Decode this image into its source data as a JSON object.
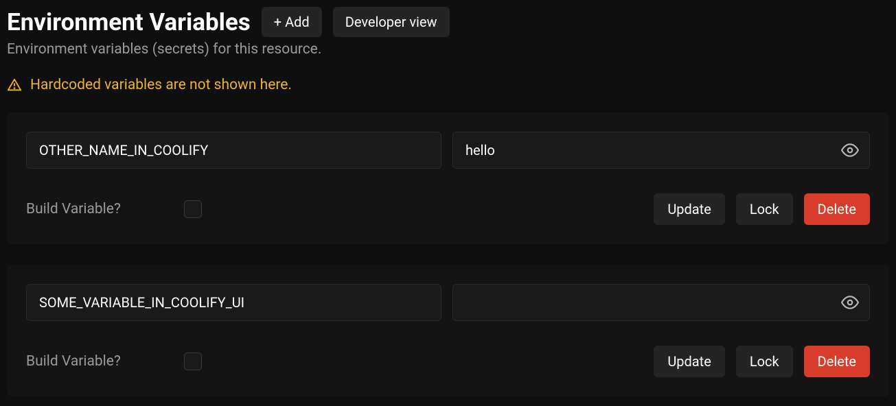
{
  "header": {
    "title": "Environment Variables",
    "add_button": "+ Add",
    "developer_view_button": "Developer view"
  },
  "subtitle": "Environment variables (secrets) for this resource.",
  "warning": {
    "text": "Hardcoded variables are not shown here."
  },
  "labels": {
    "build_variable": "Build Variable?",
    "update": "Update",
    "lock": "Lock",
    "delete": "Delete"
  },
  "variables": [
    {
      "name": "OTHER_NAME_IN_COOLIFY",
      "value": "hello",
      "build_variable": false
    },
    {
      "name": "SOME_VARIABLE_IN_COOLIFY_UI",
      "value": "",
      "build_variable": false
    }
  ]
}
